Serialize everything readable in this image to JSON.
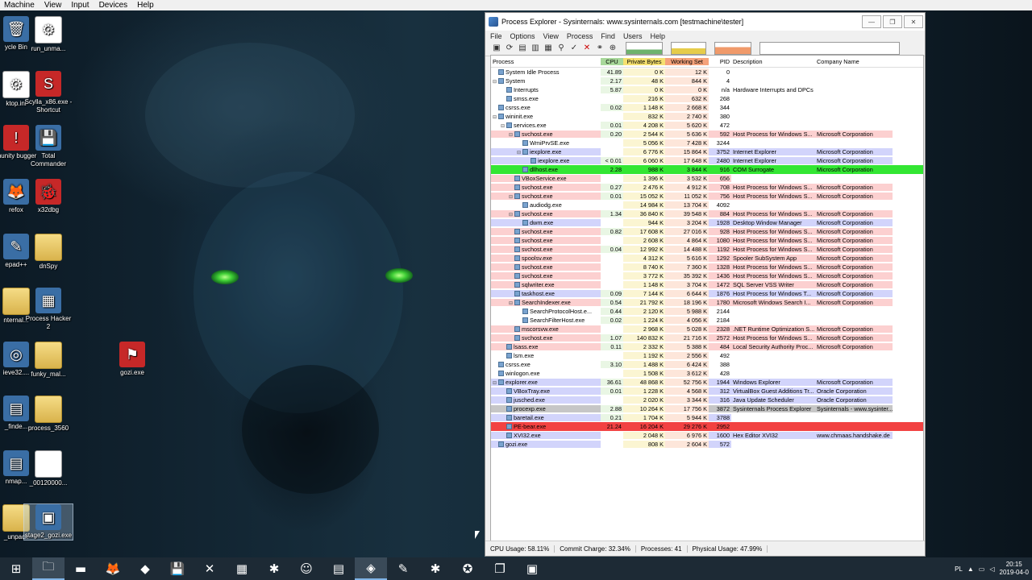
{
  "vm_menu": [
    "Machine",
    "View",
    "Input",
    "Devices",
    "Help"
  ],
  "desktop_icons": [
    {
      "label": "ycle Bin",
      "kind": "app",
      "glyph": "🗑"
    },
    {
      "label": "run_unma...",
      "kind": "doc",
      "glyph": "⚙"
    },
    {
      "label": "ktop.ini",
      "kind": "doc",
      "glyph": "⚙"
    },
    {
      "label": "Scylla_x86.exe - Shortcut",
      "kind": "red",
      "glyph": "S"
    },
    {
      "label": "munity bugger",
      "kind": "red",
      "glyph": "!"
    },
    {
      "label": "Total Commander",
      "kind": "app",
      "glyph": "💾"
    },
    {
      "label": "refox",
      "kind": "app",
      "glyph": "🦊"
    },
    {
      "label": "x32dbg",
      "kind": "red",
      "glyph": "🐞"
    },
    {
      "label": "epad++",
      "kind": "app",
      "glyph": "✎"
    },
    {
      "label": "dnSpy",
      "kind": "folder",
      "glyph": ""
    },
    {
      "label": "nternal...",
      "kind": "folder",
      "glyph": ""
    },
    {
      "label": "Process Hacker 2",
      "kind": "app",
      "glyph": "▦"
    },
    {
      "label": "gozi.exe",
      "kind": "red",
      "glyph": "⚑"
    },
    {
      "label": "ieve32....",
      "kind": "app",
      "glyph": "◎"
    },
    {
      "label": "funky_mal...",
      "kind": "folder",
      "glyph": ""
    },
    {
      "label": "_finde...",
      "kind": "app",
      "glyph": "▤"
    },
    {
      "label": "process_3560",
      "kind": "folder",
      "glyph": ""
    },
    {
      "label": "nmap...",
      "kind": "app",
      "glyph": "▤"
    },
    {
      "label": "_00120000...",
      "kind": "doc",
      "glyph": ""
    },
    {
      "label": "_unpack",
      "kind": "folder",
      "glyph": ""
    },
    {
      "label": "stage2_gozi.exe",
      "kind": "app",
      "glyph": "▣"
    }
  ],
  "window": {
    "title": "Process Explorer - Sysinternals: www.sysinternals.com [testmachine\\tester]",
    "menu": [
      "File",
      "Options",
      "View",
      "Process",
      "Find",
      "Users",
      "Help"
    ],
    "columns": {
      "name": "Process",
      "cpu": "CPU",
      "pb": "Private Bytes",
      "ws": "Working Set",
      "pid": "PID",
      "desc": "Description",
      "comp": "Company Name"
    },
    "status": {
      "cpu": "CPU Usage: 58.11%",
      "commit": "Commit Charge: 32.34%",
      "processes": "Processes: 41",
      "physical": "Physical Usage: 47.99%"
    }
  },
  "processes": [
    {
      "d": 0,
      "tw": "",
      "name": "System Idle Process",
      "cpu": "41.89",
      "pb": "0 K",
      "ws": "12 K",
      "pid": "0",
      "desc": "",
      "comp": "",
      "s": ""
    },
    {
      "d": 0,
      "tw": "⊟",
      "name": "System",
      "cpu": "2.17",
      "pb": "48 K",
      "ws": "844 K",
      "pid": "4",
      "desc": "",
      "comp": "",
      "s": ""
    },
    {
      "d": 1,
      "tw": "",
      "name": "Interrupts",
      "cpu": "5.87",
      "pb": "0 K",
      "ws": "0 K",
      "pid": "n/a",
      "desc": "Hardware Interrupts and DPCs",
      "comp": "",
      "s": ""
    },
    {
      "d": 1,
      "tw": "",
      "name": "smss.exe",
      "cpu": "",
      "pb": "216 K",
      "ws": "632 K",
      "pid": "268",
      "desc": "",
      "comp": "",
      "s": ""
    },
    {
      "d": 0,
      "tw": "",
      "name": "csrss.exe",
      "cpu": "0.02",
      "pb": "1 148 K",
      "ws": "2 668 K",
      "pid": "344",
      "desc": "",
      "comp": "",
      "s": ""
    },
    {
      "d": 0,
      "tw": "⊟",
      "name": "wininit.exe",
      "cpu": "",
      "pb": "832 K",
      "ws": "2 740 K",
      "pid": "380",
      "desc": "",
      "comp": "",
      "s": ""
    },
    {
      "d": 1,
      "tw": "⊟",
      "name": "services.exe",
      "cpu": "0.01",
      "pb": "4 208 K",
      "ws": "5 620 K",
      "pid": "472",
      "desc": "",
      "comp": "",
      "s": ""
    },
    {
      "d": 2,
      "tw": "⊟",
      "name": "svchost.exe",
      "cpu": "0.20",
      "pb": "2 544 K",
      "ws": "5 636 K",
      "pid": "592",
      "desc": "Host Process for Windows S...",
      "comp": "Microsoft Corporation",
      "s": "svc"
    },
    {
      "d": 3,
      "tw": "",
      "name": "WmiPrvSE.exe",
      "cpu": "",
      "pb": "5 056 K",
      "ws": "7 428 K",
      "pid": "3244",
      "desc": "",
      "comp": "",
      "s": ""
    },
    {
      "d": 3,
      "tw": "⊟",
      "name": "iexplore.exe",
      "cpu": "",
      "pb": "6 776 K",
      "ws": "15 864 K",
      "pid": "3752",
      "desc": "Internet Explorer",
      "comp": "Microsoft Corporation",
      "s": "own"
    },
    {
      "d": 4,
      "tw": "",
      "name": "iexplore.exe",
      "cpu": "< 0.01",
      "pb": "6 060 K",
      "ws": "17 648 K",
      "pid": "2480",
      "desc": "Internet Explorer",
      "comp": "Microsoft Corporation",
      "s": "own"
    },
    {
      "d": 3,
      "tw": "",
      "name": "dllhost.exe",
      "cpu": "2.28",
      "pb": "988 K",
      "ws": "3 844 K",
      "pid": "916",
      "desc": "COM Surrogate",
      "comp": "Microsoft Corporation",
      "s": "new"
    },
    {
      "d": 2,
      "tw": "",
      "name": "VBoxService.exe",
      "cpu": "",
      "pb": "1 396 K",
      "ws": "3 532 K",
      "pid": "656",
      "desc": "",
      "comp": "",
      "s": "svc"
    },
    {
      "d": 2,
      "tw": "",
      "name": "svchost.exe",
      "cpu": "0.27",
      "pb": "2 476 K",
      "ws": "4 912 K",
      "pid": "708",
      "desc": "Host Process for Windows S...",
      "comp": "Microsoft Corporation",
      "s": "svc"
    },
    {
      "d": 2,
      "tw": "⊟",
      "name": "svchost.exe",
      "cpu": "0.01",
      "pb": "15 052 K",
      "ws": "11 052 K",
      "pid": "756",
      "desc": "Host Process for Windows S...",
      "comp": "Microsoft Corporation",
      "s": "svc"
    },
    {
      "d": 3,
      "tw": "",
      "name": "audiodg.exe",
      "cpu": "",
      "pb": "14 984 K",
      "ws": "13 704 K",
      "pid": "4092",
      "desc": "",
      "comp": "",
      "s": ""
    },
    {
      "d": 2,
      "tw": "⊟",
      "name": "svchost.exe",
      "cpu": "1.34",
      "pb": "36 840 K",
      "ws": "39 548 K",
      "pid": "884",
      "desc": "Host Process for Windows S...",
      "comp": "Microsoft Corporation",
      "s": "svc"
    },
    {
      "d": 3,
      "tw": "",
      "name": "dwm.exe",
      "cpu": "",
      "pb": "944 K",
      "ws": "3 204 K",
      "pid": "1928",
      "desc": "Desktop Window Manager",
      "comp": "Microsoft Corporation",
      "s": "own"
    },
    {
      "d": 2,
      "tw": "",
      "name": "svchost.exe",
      "cpu": "0.82",
      "pb": "17 608 K",
      "ws": "27 016 K",
      "pid": "928",
      "desc": "Host Process for Windows S...",
      "comp": "Microsoft Corporation",
      "s": "svc"
    },
    {
      "d": 2,
      "tw": "",
      "name": "svchost.exe",
      "cpu": "",
      "pb": "2 608 K",
      "ws": "4 864 K",
      "pid": "1080",
      "desc": "Host Process for Windows S...",
      "comp": "Microsoft Corporation",
      "s": "svc"
    },
    {
      "d": 2,
      "tw": "",
      "name": "svchost.exe",
      "cpu": "0.04",
      "pb": "12 992 K",
      "ws": "14 488 K",
      "pid": "1192",
      "desc": "Host Process for Windows S...",
      "comp": "Microsoft Corporation",
      "s": "svc"
    },
    {
      "d": 2,
      "tw": "",
      "name": "spoolsv.exe",
      "cpu": "",
      "pb": "4 312 K",
      "ws": "5 616 K",
      "pid": "1292",
      "desc": "Spooler SubSystem App",
      "comp": "Microsoft Corporation",
      "s": "svc"
    },
    {
      "d": 2,
      "tw": "",
      "name": "svchost.exe",
      "cpu": "",
      "pb": "8 740 K",
      "ws": "7 360 K",
      "pid": "1328",
      "desc": "Host Process for Windows S...",
      "comp": "Microsoft Corporation",
      "s": "svc"
    },
    {
      "d": 2,
      "tw": "",
      "name": "svchost.exe",
      "cpu": "",
      "pb": "3 772 K",
      "ws": "35 392 K",
      "pid": "1436",
      "desc": "Host Process for Windows S...",
      "comp": "Microsoft Corporation",
      "s": "svc"
    },
    {
      "d": 2,
      "tw": "",
      "name": "sqlwriter.exe",
      "cpu": "",
      "pb": "1 148 K",
      "ws": "3 704 K",
      "pid": "1472",
      "desc": "SQL Server VSS Writer",
      "comp": "Microsoft Corporation",
      "s": "svc"
    },
    {
      "d": 2,
      "tw": "",
      "name": "taskhost.exe",
      "cpu": "0.09",
      "pb": "7 144 K",
      "ws": "6 644 K",
      "pid": "1876",
      "desc": "Host Process for Windows T...",
      "comp": "Microsoft Corporation",
      "s": "own"
    },
    {
      "d": 2,
      "tw": "⊟",
      "name": "SearchIndexer.exe",
      "cpu": "0.54",
      "pb": "21 792 K",
      "ws": "18 196 K",
      "pid": "1780",
      "desc": "Microsoft Windows Search I...",
      "comp": "Microsoft Corporation",
      "s": "svc"
    },
    {
      "d": 3,
      "tw": "",
      "name": "SearchProtocolHost.e...",
      "cpu": "0.44",
      "pb": "2 120 K",
      "ws": "5 988 K",
      "pid": "2144",
      "desc": "",
      "comp": "",
      "s": ""
    },
    {
      "d": 3,
      "tw": "",
      "name": "SearchFilterHost.exe",
      "cpu": "0.02",
      "pb": "1 224 K",
      "ws": "4 056 K",
      "pid": "2184",
      "desc": "",
      "comp": "",
      "s": ""
    },
    {
      "d": 2,
      "tw": "",
      "name": "mscorsvw.exe",
      "cpu": "",
      "pb": "2 968 K",
      "ws": "5 028 K",
      "pid": "2328",
      "desc": ".NET Runtime Optimization S...",
      "comp": "Microsoft Corporation",
      "s": "svc"
    },
    {
      "d": 2,
      "tw": "",
      "name": "svchost.exe",
      "cpu": "1.07",
      "pb": "140 832 K",
      "ws": "21 716 K",
      "pid": "2572",
      "desc": "Host Process for Windows S...",
      "comp": "Microsoft Corporation",
      "s": "svc"
    },
    {
      "d": 1,
      "tw": "",
      "name": "lsass.exe",
      "cpu": "0.11",
      "pb": "2 332 K",
      "ws": "5 388 K",
      "pid": "484",
      "desc": "Local Security Authority Proc...",
      "comp": "Microsoft Corporation",
      "s": "svc"
    },
    {
      "d": 1,
      "tw": "",
      "name": "lsm.exe",
      "cpu": "",
      "pb": "1 192 K",
      "ws": "2 556 K",
      "pid": "492",
      "desc": "",
      "comp": "",
      "s": ""
    },
    {
      "d": 0,
      "tw": "",
      "name": "csrss.exe",
      "cpu": "3.10",
      "pb": "1 488 K",
      "ws": "6 424 K",
      "pid": "388",
      "desc": "",
      "comp": "",
      "s": ""
    },
    {
      "d": 0,
      "tw": "",
      "name": "winlogon.exe",
      "cpu": "",
      "pb": "1 508 K",
      "ws": "3 612 K",
      "pid": "428",
      "desc": "",
      "comp": "",
      "s": ""
    },
    {
      "d": 0,
      "tw": "⊟",
      "name": "explorer.exe",
      "cpu": "36.61",
      "pb": "48 868 K",
      "ws": "52 756 K",
      "pid": "1944",
      "desc": "Windows Explorer",
      "comp": "Microsoft Corporation",
      "s": "own"
    },
    {
      "d": 1,
      "tw": "",
      "name": "VBoxTray.exe",
      "cpu": "0.01",
      "pb": "1 228 K",
      "ws": "4 568 K",
      "pid": "312",
      "desc": "VirtualBox Guest Additions Tr...",
      "comp": "Oracle Corporation",
      "s": "own"
    },
    {
      "d": 1,
      "tw": "",
      "name": "jusched.exe",
      "cpu": "",
      "pb": "2 020 K",
      "ws": "3 344 K",
      "pid": "316",
      "desc": "Java Update Scheduler",
      "comp": "Oracle Corporation",
      "s": "own"
    },
    {
      "d": 1,
      "tw": "",
      "name": "procexp.exe",
      "cpu": "2.88",
      "pb": "10 264 K",
      "ws": "17 756 K",
      "pid": "3872",
      "desc": "Sysinternals Process Explorer",
      "comp": "Sysinternals - www.sysinter...",
      "s": "sel"
    },
    {
      "d": 1,
      "tw": "",
      "name": "baretail.exe",
      "cpu": "0.21",
      "pb": "1 704 K",
      "ws": "5 944 K",
      "pid": "3788",
      "desc": "",
      "comp": "",
      "s": "own"
    },
    {
      "d": 1,
      "tw": "",
      "name": "PE-bear.exe",
      "cpu": "21.24",
      "pb": "16 204 K",
      "ws": "29 276 K",
      "pid": "2952",
      "desc": "",
      "comp": "",
      "s": "kill"
    },
    {
      "d": 1,
      "tw": "",
      "name": "XVI32.exe",
      "cpu": "",
      "pb": "2 048 K",
      "ws": "6 976 K",
      "pid": "1600",
      "desc": "Hex Editor XVI32",
      "comp": "www.chmaas.handshake.de",
      "s": "own"
    },
    {
      "d": 0,
      "tw": "",
      "name": "gozi.exe",
      "cpu": "",
      "pb": "808 K",
      "ws": "2 604 K",
      "pid": "572",
      "desc": "",
      "comp": "",
      "s": "own"
    }
  ],
  "taskbar": {
    "items": [
      "⊞",
      "🗀",
      "▬",
      "🦊",
      "◆",
      "💾",
      "✕",
      "▦",
      "✱",
      "☺",
      "▤",
      "◈",
      "✎",
      "✱",
      "✪",
      "❐",
      "▣"
    ],
    "lang": "PL",
    "time": "20:15",
    "date": "2019-04-0"
  }
}
